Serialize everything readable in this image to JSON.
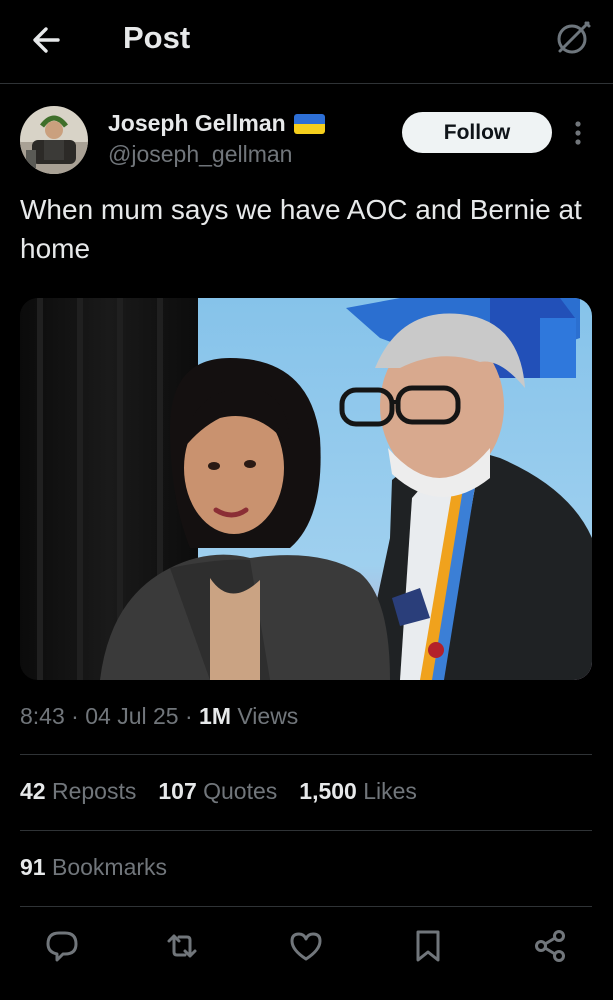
{
  "header": {
    "title": "Post",
    "back_icon": "arrow-left-icon",
    "grok_icon": "grok-icon"
  },
  "author": {
    "name": "Joseph Gellman",
    "handle": "@joseph_gellman",
    "flag": "ukraine-flag",
    "follow_label": "Follow",
    "more_icon": "more-vertical-icon"
  },
  "post": {
    "text": "When mum says we have AOC and Bernie at home",
    "time": "8:43",
    "date": "04 Jul 25",
    "views_count": "1M",
    "views_label": "Views"
  },
  "stats": {
    "reposts_count": "42",
    "reposts_label": "Reposts",
    "quotes_count": "107",
    "quotes_label": "Quotes",
    "likes_count": "1,500",
    "likes_label": "Likes",
    "bookmarks_count": "91",
    "bookmarks_label": "Bookmarks"
  },
  "action_bar": [
    "reply-icon",
    "repost-icon",
    "like-icon",
    "bookmark-icon",
    "share-icon"
  ],
  "colors": {
    "background": "#000000",
    "text": "#e7e9ea",
    "muted": "#71767b",
    "divider": "#2f3336",
    "follow_bg": "#eff3f4"
  }
}
